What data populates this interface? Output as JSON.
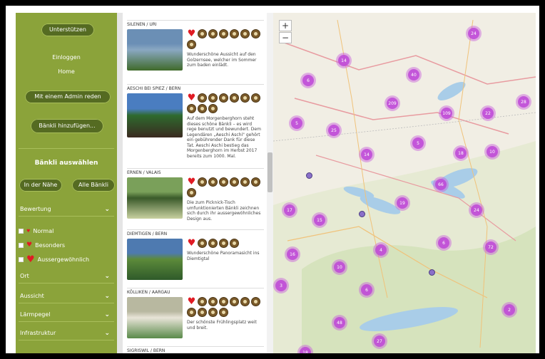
{
  "sidebar": {
    "support_label": "Unterstützen",
    "login_label": "Einloggen",
    "home_label": "Home",
    "admin_label": "Mit einem Admin reden",
    "add_label": "Bänkli hinzufügen...",
    "select_title": "Bänkli auswählen",
    "nearby_label": "In der Nähe",
    "all_label": "Alle Bänkli",
    "filters": {
      "rating": "Bewertung",
      "place": "Ort",
      "view": "Aussicht",
      "noise": "Lärmpegel",
      "infra": "Infrastruktur"
    },
    "ratings": {
      "normal": "Normal",
      "special": "Besonders",
      "extraordinary": "Aussergewöhnlich"
    }
  },
  "cards": [
    {
      "place": "SILENEN / URI",
      "badges": 7,
      "desc": "Wunderschöne Aussicht auf den Golzernsee, welcher im Sommer zum baden einlädt."
    },
    {
      "place": "AESCHI BEI SPIEZ / BERN",
      "badges": 9,
      "desc": "Auf dem Morgenberghorn steht dieses schöne Bänkli – es wird rege benutzt und bewundert. Dem Legendären „Aeschi Aschi\" gehört ein gebührender Dank für diese Tat. Aeschi Aschi bestieg das Morgenberghorn im Herbst 2017 bereits zum 1000. Mal."
    },
    {
      "place": "ERNEN / VALAIS",
      "badges": 7,
      "desc": "Die zum Picknick-Tisch umfunktionierten Bänkli zeichnen sich durch ihr aussergewöhnliches Design aus."
    },
    {
      "place": "DIEMTIGEN / BERN",
      "badges": 4,
      "desc": "Wunderschöne Panoramasicht ins Diemtigtal"
    },
    {
      "place": "KÖLLIKEN / AARGAU",
      "badges": 10,
      "desc": "Der schönste Frühlingsplatz weit und breit."
    },
    {
      "place": "SIGRISWIL / BERN",
      "badges": 0,
      "desc": ""
    }
  ],
  "map": {
    "zoom_in": "+",
    "zoom_out": "−",
    "clusters": [
      "24",
      "14",
      "40",
      "6",
      "209",
      "28",
      "5",
      "25",
      "109",
      "22",
      "5",
      "14",
      "18",
      "10",
      "66",
      "17",
      "15",
      "19",
      "24",
      "6",
      "4",
      "72",
      "16",
      "10",
      "3",
      "6",
      "2",
      "48",
      "27",
      "18"
    ]
  },
  "colors": {
    "sidebar": "#8ba33a",
    "pill": "#556b22",
    "heart": "#e01b24",
    "cluster": "#c046d8"
  }
}
